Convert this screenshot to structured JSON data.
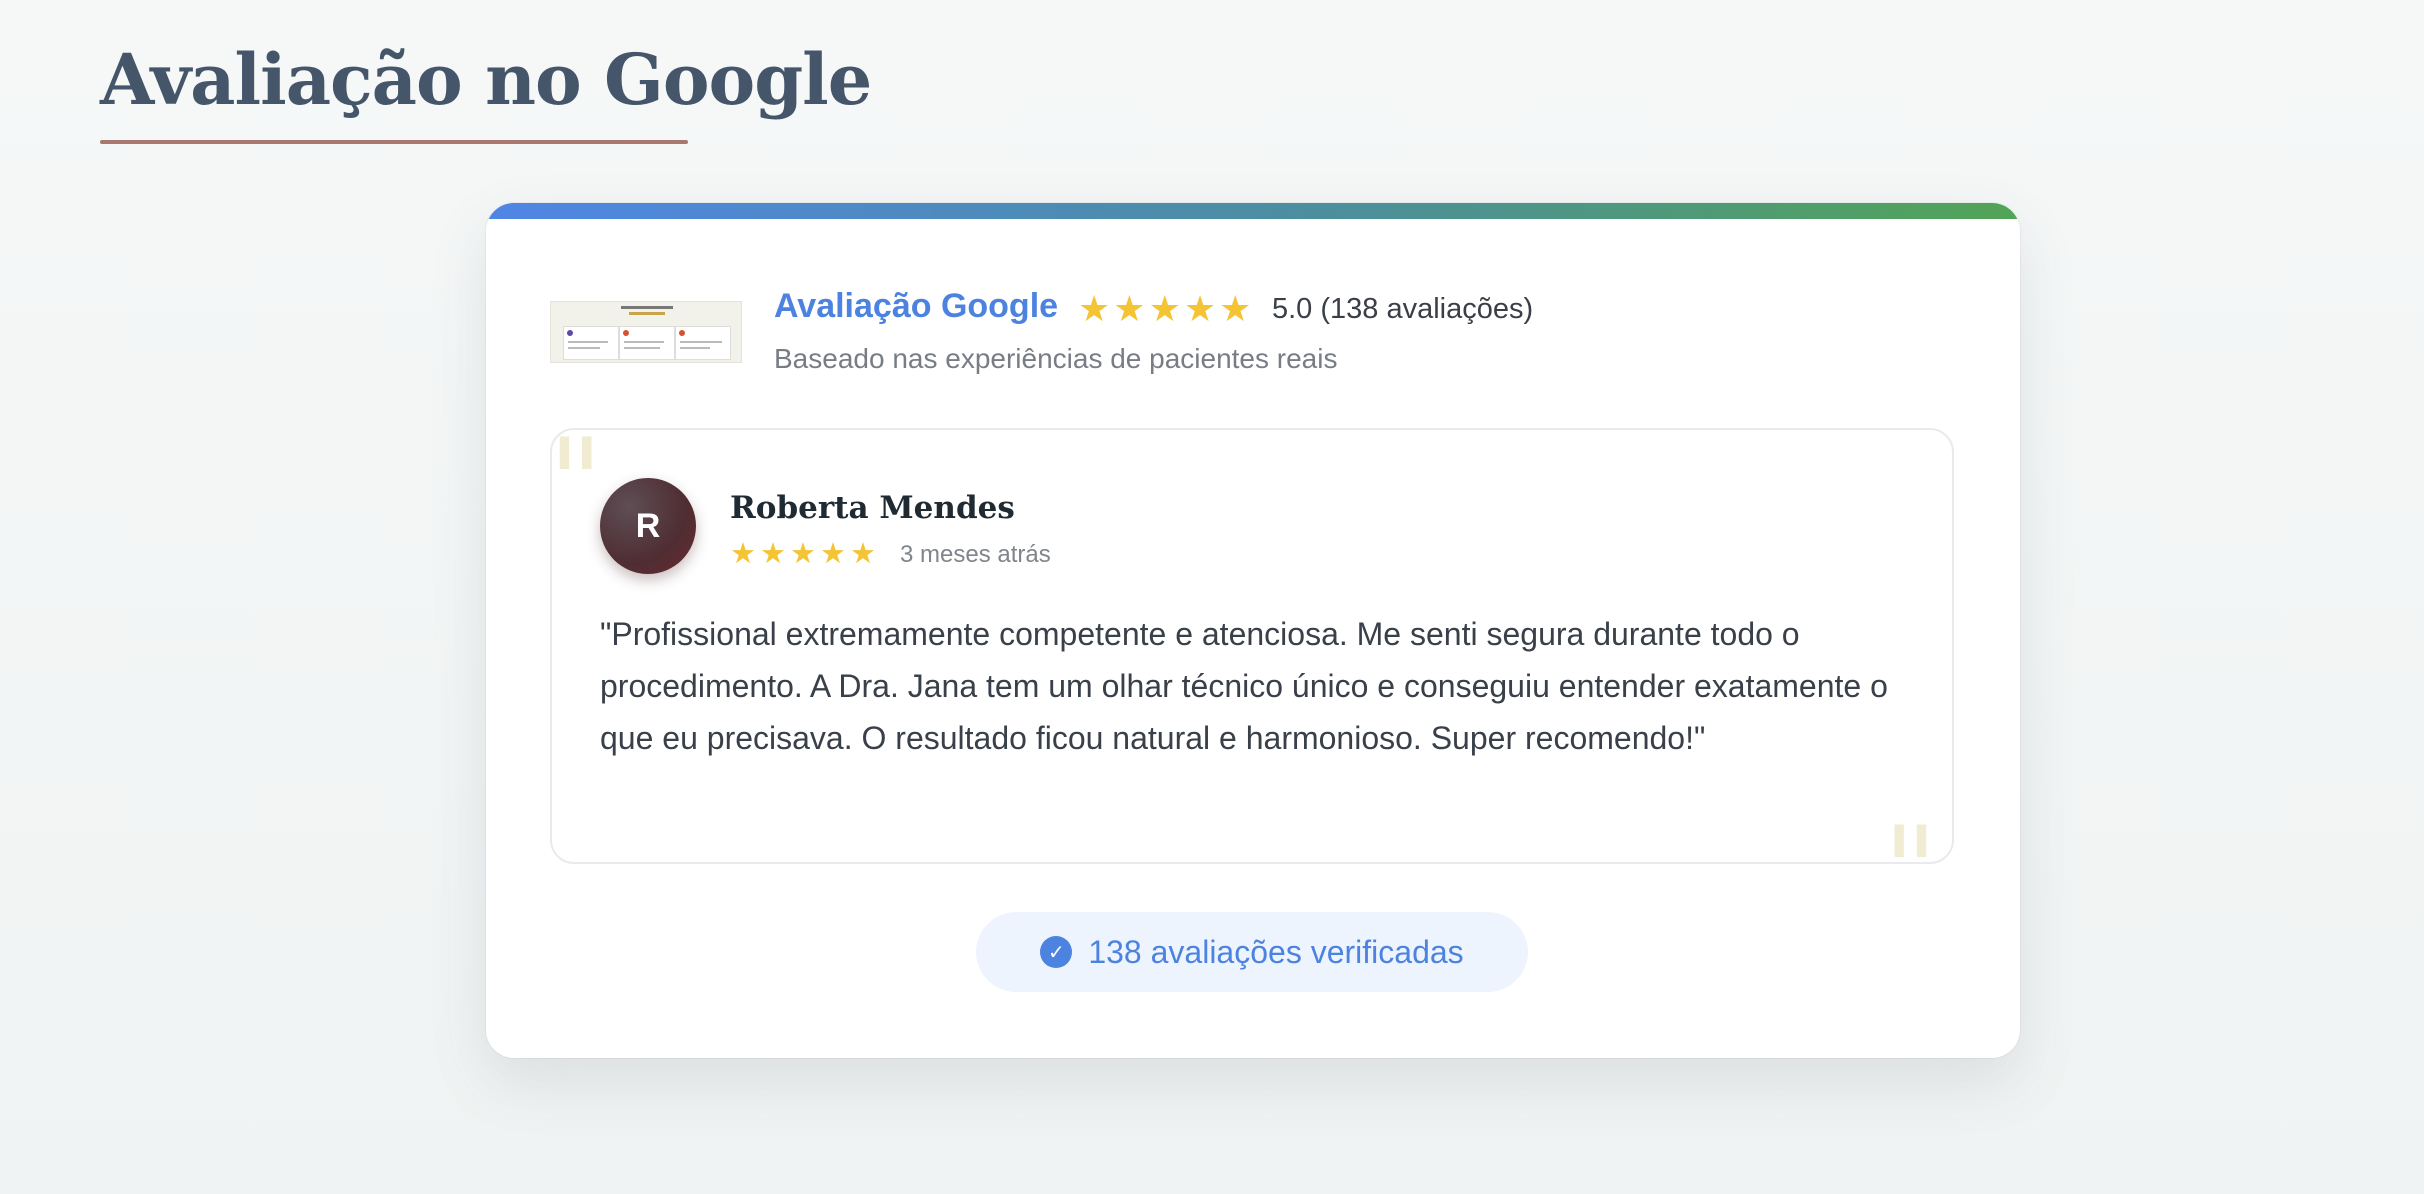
{
  "page": {
    "title": "Avaliação no Google"
  },
  "card": {
    "title": "Avaliação Google",
    "rating_text": "5.0 (138 avaliações)",
    "rating_stars": 5,
    "subtitle": "Baseado nas experiências de pacientes reais",
    "verified_text": "138 avaliações verificadas"
  },
  "review": {
    "avatar_initial": "R",
    "name": "Roberta Mendes",
    "stars": 5,
    "time": "3 meses atrás",
    "text": "\"Profissional extremamente competente e atenciosa. Me senti segura durante todo o procedimento. A Dra. Jana tem um olhar técnico único e conseguiu entender exatamente o que eu precisava. O resultado ficou natural e harmonioso. Super recomendo!\""
  },
  "icons": {
    "star": "star-icon",
    "check": "check-circle-icon",
    "quote": "quote-icon"
  },
  "colors": {
    "brand_blue": "#4c82e0",
    "star_yellow": "#f4c434",
    "title_slate": "#45566a",
    "underline_rose": "#a8776f",
    "bar_green": "#52a456"
  }
}
